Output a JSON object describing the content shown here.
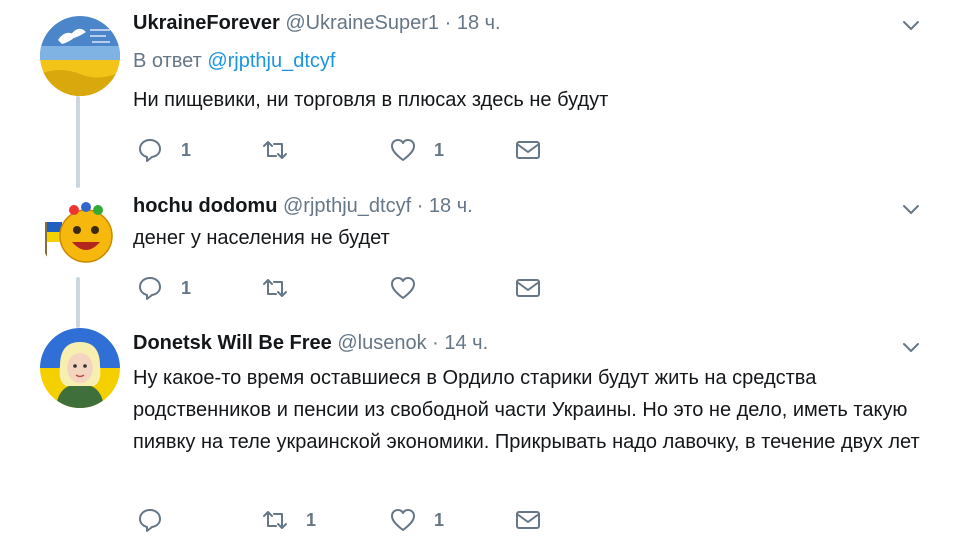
{
  "colors": {
    "text": "#14171a",
    "secondary": "#657786",
    "link": "#1b95e0",
    "thread_line": "#ccd6dd"
  },
  "tweets": [
    {
      "name": "UkraineForever",
      "handle": "@UkraineSuper1",
      "dot": "·",
      "time": "18 ч.",
      "reply_prefix": "В ответ",
      "reply_to": "@rjpthju_dtcyf",
      "text": "Ни пищевики, ни торговля в плюсах здесь не будут",
      "avatar_icon": "ukraine-dove-avatar",
      "reply_count": "1",
      "retweet_count": "",
      "like_count": "1"
    },
    {
      "name": "hochu dodomu",
      "handle": "@rjpthju_dtcyf",
      "dot": "·",
      "time": "18 ч.",
      "text": "денег у населения не будет",
      "avatar_icon": "emoji-flag-avatar",
      "reply_count": "1",
      "retweet_count": "",
      "like_count": ""
    },
    {
      "name": "Donetsk Will Be Free",
      "handle": "@lusenok",
      "dot": "·",
      "time": "14 ч.",
      "text": "Ну какое-то время оставшиеся в Ордило старики будут жить на средства родственников и пенсии из свободной части Украины. Но это не дело, иметь такую пиявку на теле украинской экономики. Прикрывать надо лавочку, в течение двух лет",
      "avatar_icon": "woman-illustration-avatar",
      "reply_count": "",
      "retweet_count": "1",
      "like_count": "1"
    }
  ]
}
